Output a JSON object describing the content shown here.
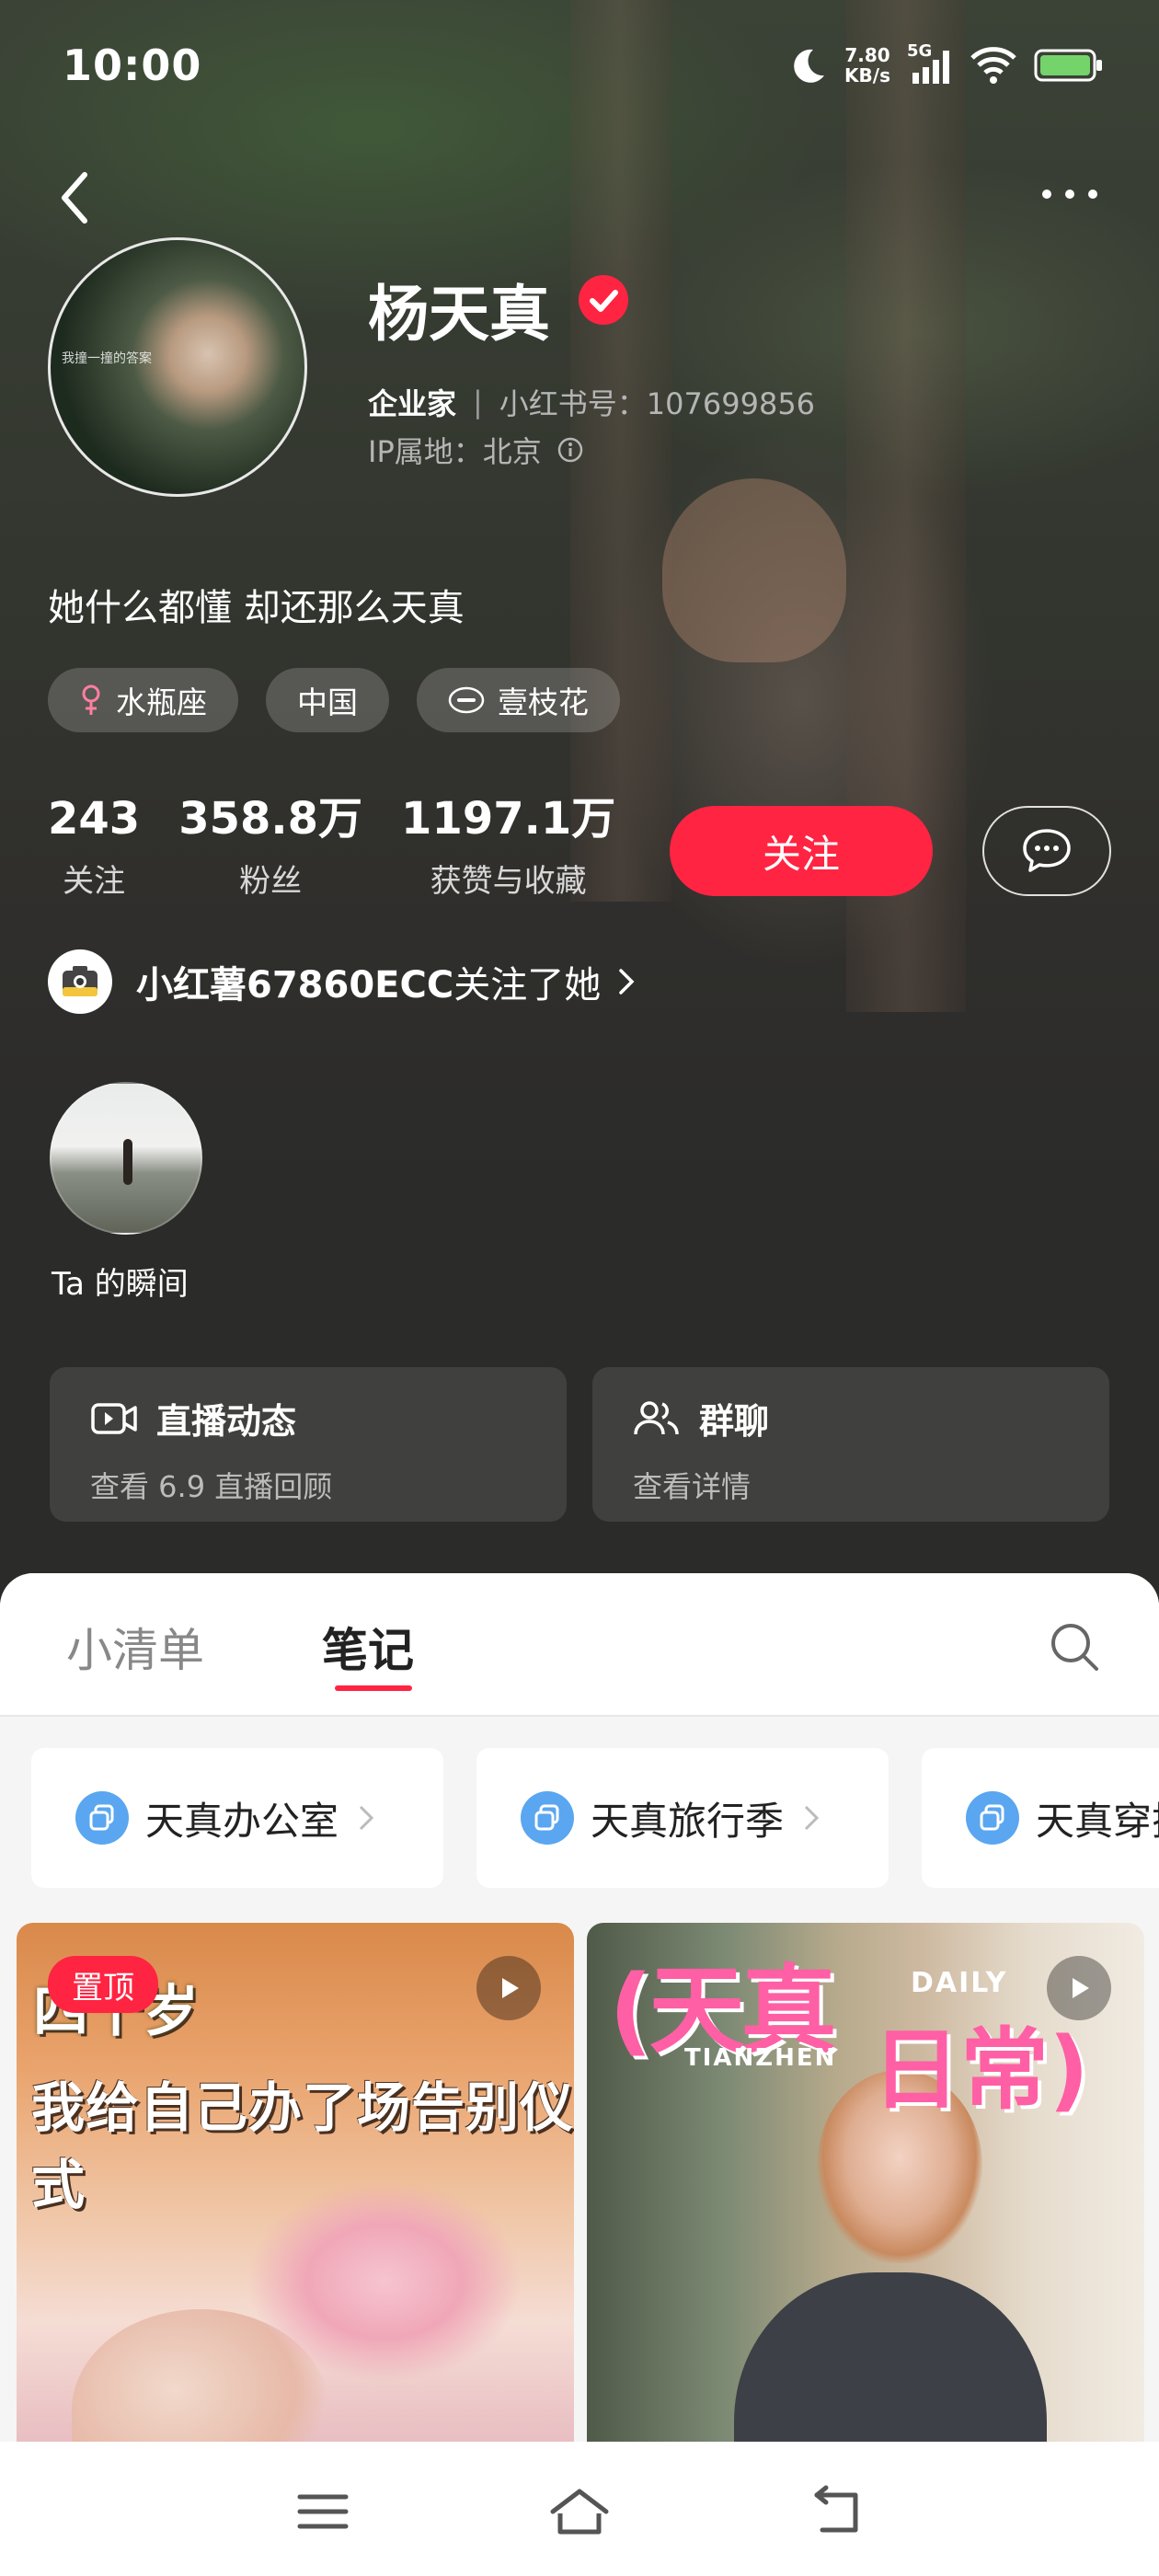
{
  "status_bar": {
    "time": "10:00",
    "net_speed": "7.80",
    "net_unit": "KB/s",
    "signal": "5G",
    "icons": [
      "moon-icon",
      "signal-icon",
      "wifi-icon",
      "battery-icon"
    ]
  },
  "profile": {
    "name": "杨天真",
    "title": "企业家",
    "id_label": "小红书号：107699856",
    "ip_label": "IP属地：北京",
    "avatar_caption": "我撞一撞的答案",
    "bio": "她什么都懂 却还那么天真",
    "tags": [
      "水瓶座",
      "中国",
      "壹枝花"
    ]
  },
  "stats": [
    {
      "value": "243",
      "label": "关注"
    },
    {
      "value": "358.8万",
      "label": "粉丝"
    },
    {
      "value": "1197.1万",
      "label": "获赞与收藏"
    }
  ],
  "actions": {
    "follow_label": "关注"
  },
  "followed_by": {
    "user": "小红薯67860ECC",
    "text": " 关注了她"
  },
  "moment": {
    "label": "Ta 的瞬间"
  },
  "cards": [
    {
      "title": "直播动态",
      "subtitle": "查看 6.9 直播回顾"
    },
    {
      "title": "群聊",
      "subtitle": "查看详情"
    }
  ],
  "tabs": [
    "小清单",
    "笔记"
  ],
  "collections": [
    "天真办公室",
    "天真旅行季",
    "天真穿搭"
  ],
  "posts": [
    {
      "badge": "置顶",
      "line1": "四十岁",
      "line2": "我给自己办了场告别仪式"
    },
    {
      "title_a": "(天真",
      "title_b": "日常)",
      "daily": "DAILY",
      "tianzhen": "TIANZHEN"
    }
  ],
  "colors": {
    "accent": "#ff2442",
    "collection_icon": "#5aa6f0",
    "panel_bg": "#f5f5f5"
  }
}
